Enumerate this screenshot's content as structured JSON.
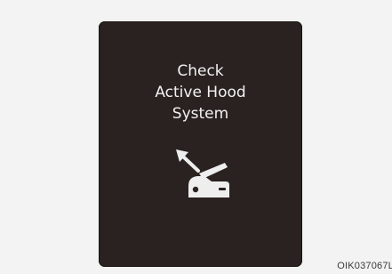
{
  "display": {
    "message_lines": [
      "Check",
      "Active Hood",
      "System"
    ],
    "icon": "active-hood-warning-icon",
    "background_color": "#2a2220",
    "text_color": "#f2f2f2"
  },
  "figure": {
    "code": "OIK037067L"
  }
}
